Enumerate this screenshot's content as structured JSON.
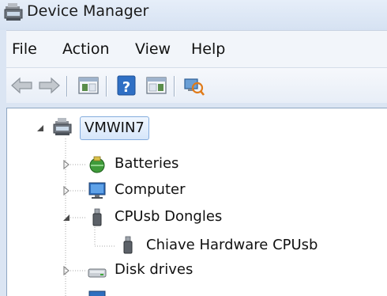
{
  "window": {
    "title": "Device Manager"
  },
  "menubar": {
    "items": [
      {
        "label": "File"
      },
      {
        "label": "Action"
      },
      {
        "label": "View"
      },
      {
        "label": "Help"
      }
    ]
  },
  "toolbar": {
    "buttons": [
      {
        "icon": "back-arrow-icon"
      },
      {
        "icon": "forward-arrow-icon"
      },
      {
        "icon": "show-hide-console-tree-icon"
      },
      {
        "icon": "help-icon"
      },
      {
        "icon": "show-hide-action-pane-icon"
      },
      {
        "icon": "scan-hardware-changes-icon"
      }
    ]
  },
  "tree": {
    "root": {
      "label": "VMWIN7",
      "icon": "computer-icon",
      "expanded": true,
      "selected": true
    },
    "items": [
      {
        "label": "Batteries",
        "icon": "battery-icon",
        "expanded": false
      },
      {
        "label": "Computer",
        "icon": "monitor-icon",
        "expanded": false
      },
      {
        "label": "CPUsb Dongles",
        "icon": "usb-dongle-icon",
        "expanded": true,
        "children": [
          {
            "label": "Chiave Hardware CPUsb",
            "icon": "usb-dongle-icon"
          }
        ]
      },
      {
        "label": "Disk drives",
        "icon": "disk-drive-icon",
        "expanded": false
      }
    ]
  }
}
